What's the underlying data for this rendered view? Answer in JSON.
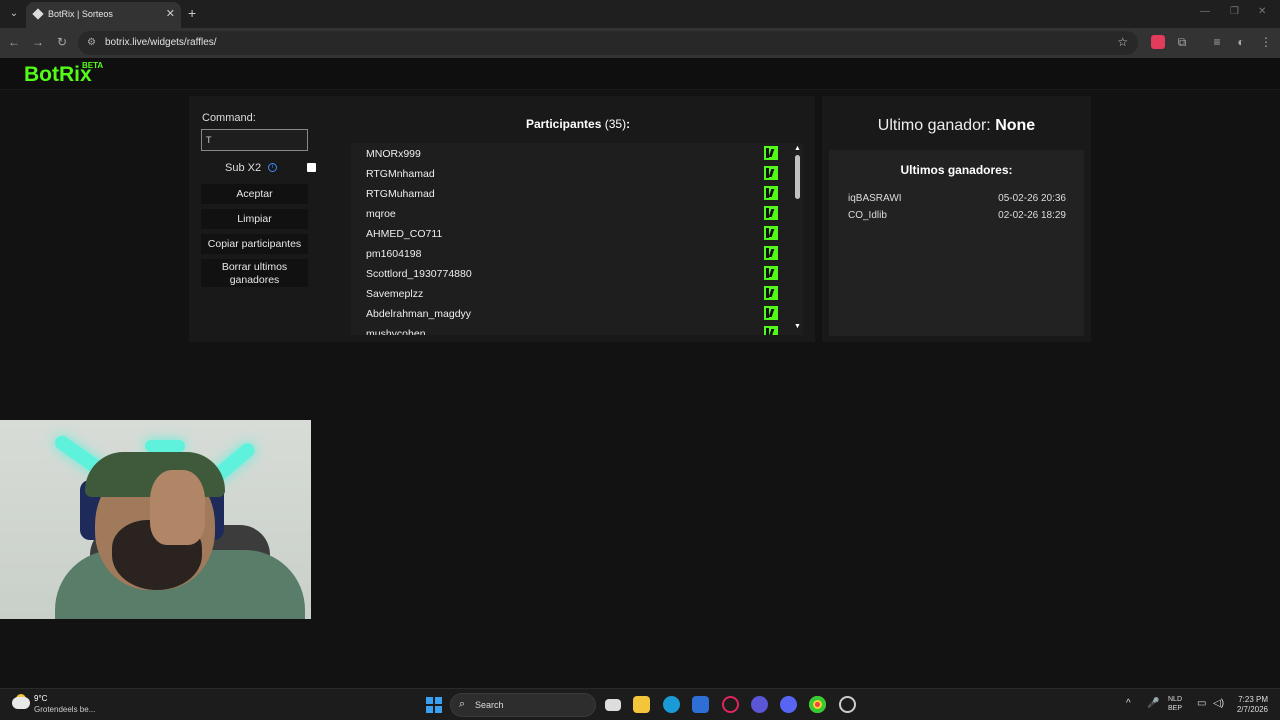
{
  "browser": {
    "tab_title": "BotRix | Sorteos",
    "url": "botrix.live/widgets/raffles/",
    "new_tab": "+",
    "tab_close": "✕"
  },
  "app": {
    "logo": "BotRix",
    "badge": "BETA"
  },
  "controls": {
    "command_label": "Command:",
    "command_value": "T",
    "sub_label": "Sub X2",
    "sub_checked": false,
    "buttons": {
      "accept": "Aceptar",
      "clear": "Limpiar",
      "copy": "Copiar participantes",
      "delete": "Borrar ultimos ganadores"
    }
  },
  "participants": {
    "title": "Participantes",
    "count": "(35)",
    "colon": ":",
    "list": [
      "MNORx999",
      "RTGMnhamad",
      "RTGMuhamad",
      "mqroe",
      "AHMED_CO711",
      "pm1604198",
      "Scottlord_1930774880",
      "Savemeplzz",
      "Abdelrahman_magdyy",
      "mushycohen"
    ],
    "platform_icon": "kick-icon",
    "accent": "#53fc18"
  },
  "winner": {
    "label": "Ultimo ganador:",
    "value": "None",
    "history_title": "Ultimos ganadores:",
    "history": [
      {
        "name": "iqBASRAWI",
        "date": "05-02-26 20:36"
      },
      {
        "name": "CO_Idlib",
        "date": "02-02-26 18:29"
      }
    ]
  },
  "taskbar": {
    "temp": "9°C",
    "weather_desc": "Grotendeels be...",
    "search": "Search",
    "lang_1": "NLD",
    "lang_2": "BEP",
    "time": "7:23 PM",
    "date": "2/7/2026"
  }
}
